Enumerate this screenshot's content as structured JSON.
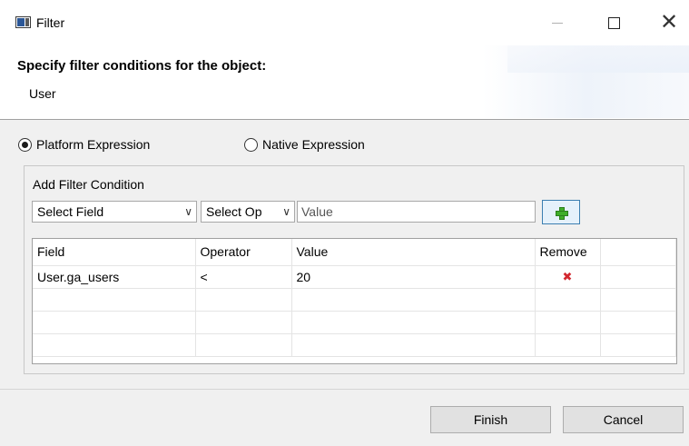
{
  "window": {
    "title": "Filter"
  },
  "header": {
    "title": "Specify filter conditions for the object:",
    "subtitle": "User"
  },
  "expression": {
    "platform_label": "Platform Expression",
    "native_label": "Native Expression",
    "selected": "platform"
  },
  "add_condition": {
    "group_title": "Add Filter Condition",
    "field_select": "Select Field",
    "operator_select": "Select Op",
    "value_placeholder": "Value"
  },
  "table": {
    "columns": [
      "Field",
      "Operator",
      "Value",
      "Remove",
      ""
    ],
    "rows": [
      {
        "field": "User.ga_users",
        "operator": "<",
        "value": "20"
      }
    ]
  },
  "buttons": {
    "finish": "Finish",
    "cancel": "Cancel"
  },
  "icons": {
    "add": "plus-icon",
    "remove": "x-icon"
  },
  "colors": {
    "add_icon": "#3fae29",
    "remove_icon": "#d2272e",
    "add_button_border": "#3c7fb1"
  }
}
